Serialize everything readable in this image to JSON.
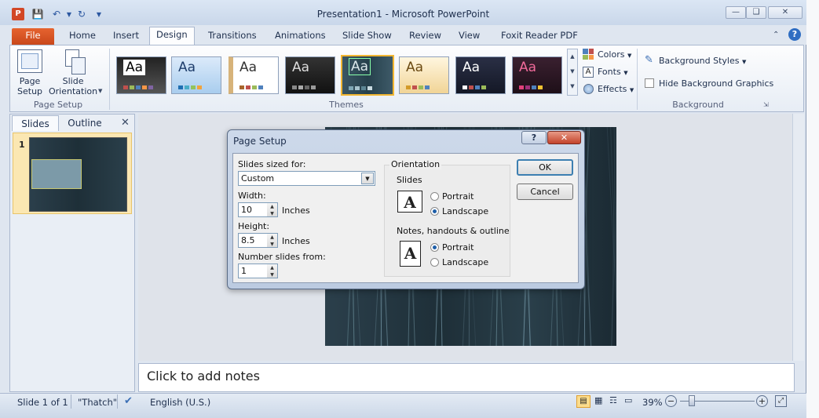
{
  "window": {
    "title": "Presentation1  -  Microsoft PowerPoint",
    "app_icon": "P"
  },
  "tabs": [
    "File",
    "Home",
    "Insert",
    "Design",
    "Transitions",
    "Animations",
    "Slide Show",
    "Review",
    "View",
    "Foxit Reader PDF"
  ],
  "active_tab": "Design",
  "ribbon": {
    "page_setup": {
      "page_setup_label": "Page\nSetup",
      "orientation_label": "Slide\nOrientation",
      "group_label": "Page Setup"
    },
    "themes": {
      "theme_text": "Aa",
      "group_label": "Themes",
      "colors": "Colors",
      "fonts": "Fonts",
      "effects": "Effects"
    },
    "background": {
      "styles": "Background Styles",
      "hide_graphics": "Hide Background Graphics",
      "group_label": "Background"
    }
  },
  "left_pane": {
    "tab_slides": "Slides",
    "tab_outline": "Outline",
    "slide_number": "1"
  },
  "notes": {
    "placeholder": "Click to add notes"
  },
  "status": {
    "slide": "Slide 1 of 1",
    "theme": "\"Thatch\"",
    "language": "English (U.S.)",
    "zoom": "39%"
  },
  "dialog": {
    "title": "Page Setup",
    "slides_sized_for_label": "Slides sized for:",
    "slides_sized_for_value": "Custom",
    "width_label": "Width:",
    "width_value": "10",
    "height_label": "Height:",
    "height_value": "8.5",
    "inches": "Inches",
    "number_from_label": "Number slides from:",
    "number_from_value": "1",
    "orientation_label": "Orientation",
    "slides_group": "Slides",
    "notes_group": "Notes, handouts & outline",
    "portrait": "Portrait",
    "landscape": "Landscape",
    "slides_orientation": "Landscape",
    "notes_orientation": "Portrait",
    "ok": "OK",
    "cancel": "Cancel",
    "help": "?",
    "close": "✕"
  }
}
